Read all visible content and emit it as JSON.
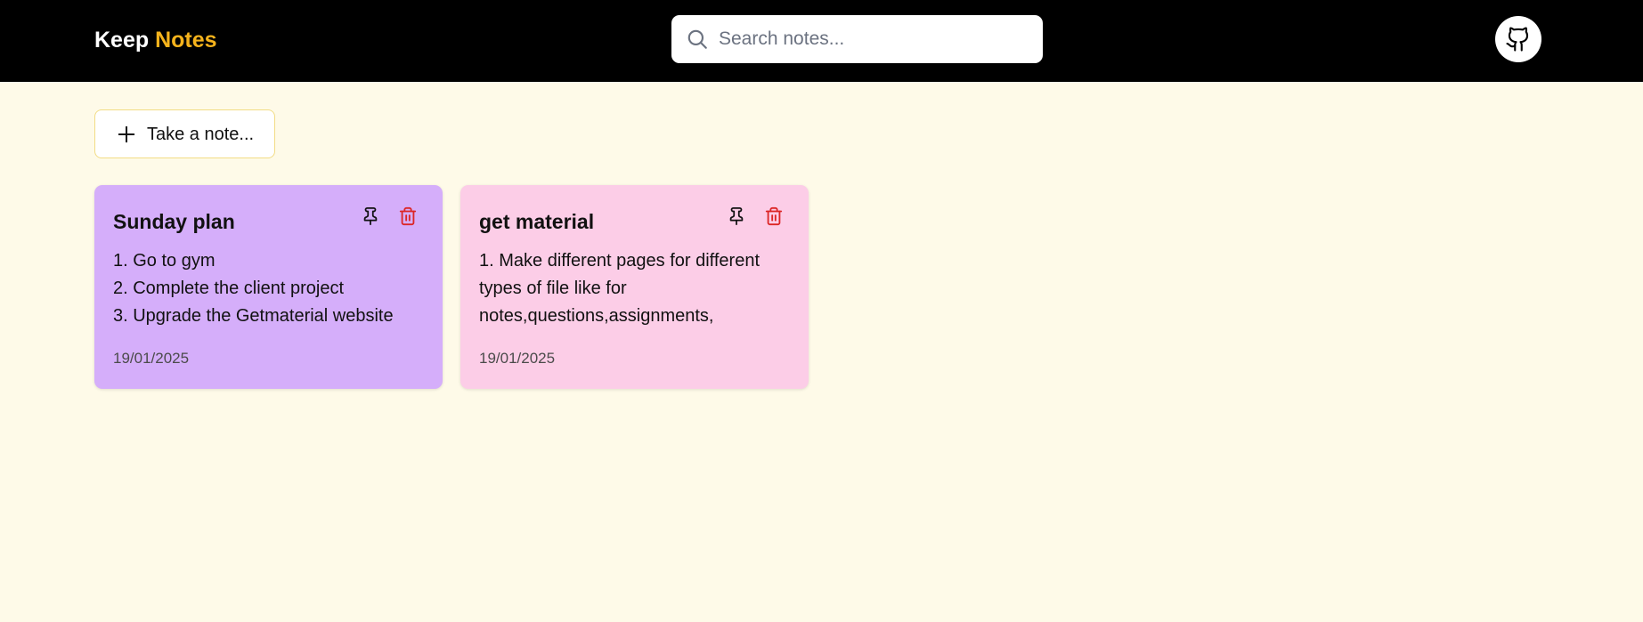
{
  "app": {
    "logo_part1": "Keep",
    "logo_part2": "Notes"
  },
  "search": {
    "placeholder": "Search notes..."
  },
  "icons": {
    "search": "search-icon",
    "github": "github-icon",
    "add": "plus-icon",
    "pin": "pin-icon",
    "delete": "trash-icon"
  },
  "take_note": {
    "label": "Take a note..."
  },
  "notes": [
    {
      "title": "Sunday plan",
      "lines": [
        "1. Go to gym",
        "2. Complete the client project",
        "3. Upgrade the Getmaterial website"
      ],
      "date": "19/01/2025",
      "color": "#d5aefa"
    },
    {
      "title": "get material",
      "lines": [
        "1. Make different pages for different",
        "types of file like for",
        "notes,questions,assignments,"
      ],
      "date": "19/01/2025",
      "color": "#fccde7"
    }
  ],
  "colors": {
    "header_bg": "#000000",
    "page_bg": "#fefae8",
    "logo_accent": "#f5b31c",
    "delete_icon": "#dc2626"
  }
}
